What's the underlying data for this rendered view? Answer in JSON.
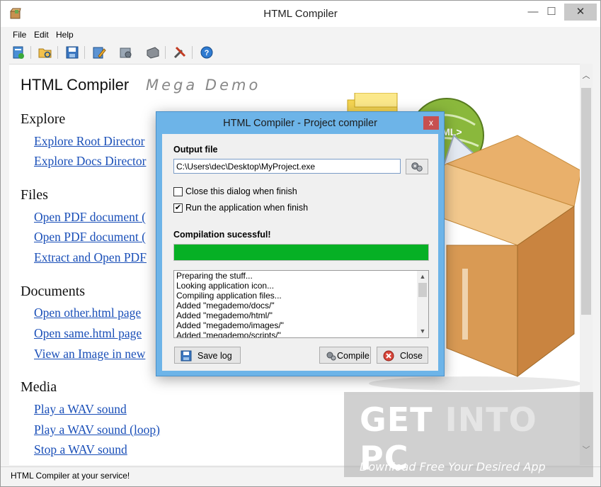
{
  "window": {
    "title": "HTML Compiler",
    "minimize": "—",
    "maximize": "☐",
    "close": "✕"
  },
  "menu": [
    "File",
    "Edit",
    "Help"
  ],
  "toolbar": {
    "icons": [
      "new-project-icon",
      "open-folder-icon",
      "save-icon",
      "edit-icon",
      "settings-icon",
      "compile-icon",
      "tools-icon",
      "help-icon"
    ]
  },
  "page": {
    "title": "HTML Compiler",
    "subtitle": "Mega Demo",
    "sections": [
      {
        "heading": "Explore",
        "links": [
          "Explore Root Director",
          "Explore Docs Director"
        ]
      },
      {
        "heading": "Files",
        "links": [
          "Open PDF document (",
          "Open PDF document (",
          "Extract and Open PDF"
        ]
      },
      {
        "heading": "Documents",
        "links": [
          "Open other.html page",
          "Open same.html page",
          "View an Image in new"
        ]
      },
      {
        "heading": "Media",
        "links": [
          "Play a WAV sound",
          "Play a WAV sound (loop)",
          "Stop a WAV sound"
        ]
      }
    ]
  },
  "box_label": "HTML>",
  "status": "HTML Compiler at your service!",
  "watermark": {
    "title_a": "GET ",
    "title_b": "INTO",
    "title_c": " PC",
    "subtitle": "Download Free Your Desired App"
  },
  "dialog": {
    "title": "HTML Compiler - Project compiler",
    "close": "x",
    "output_label": "Output file",
    "output_value": "C:\\Users\\dec\\Desktop\\MyProject.exe",
    "chk_close_label": "Close this dialog when finish",
    "chk_close_checked": false,
    "chk_run_label": "Run the application when finish",
    "chk_run_checked": true,
    "check_mark": "✔",
    "status_label": "Compilation sucessful!",
    "progress": 1.0,
    "log": [
      "Preparing the stuff...",
      "Looking application icon...",
      "Compiling application files...",
      "Added \"megademo/docs/\"",
      "Added \"megademo/html/\"",
      "Added \"megademo/images/\"",
      "Added \"megademo/scripts/\""
    ],
    "save_log": "Save log",
    "compile": "Compile",
    "close_btn": "Close",
    "scroll_up": "▲",
    "scroll_down": "▼"
  },
  "scroll": {
    "up": "︿",
    "down": "﹀"
  },
  "colors": {
    "link": "#1a4fb8",
    "progress": "#06b025",
    "dialog_frame": "#6db4e8",
    "close_red": "#c75050"
  }
}
